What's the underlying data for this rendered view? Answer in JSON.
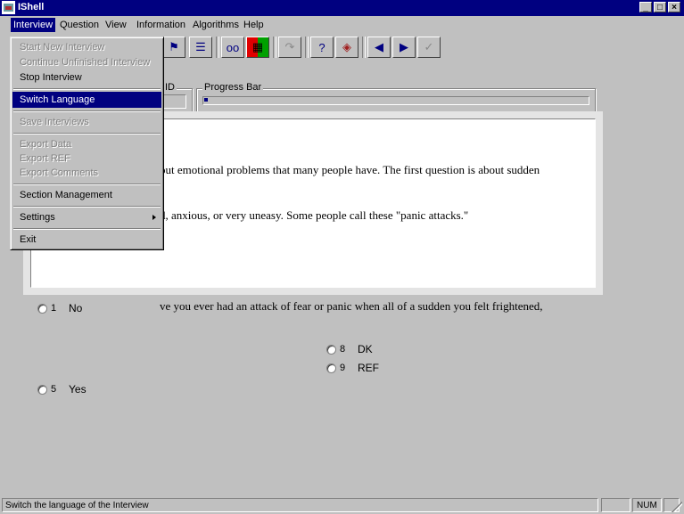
{
  "window": {
    "title": "IShell",
    "controls": [
      "minimize-icon",
      "maximize-icon",
      "close-icon"
    ]
  },
  "menubar": {
    "items": [
      "Interview",
      "Question",
      "View",
      "Information",
      "Algorithms",
      "Help"
    ]
  },
  "interview_menu": {
    "items": [
      {
        "label": "Start New Interview",
        "enabled": false
      },
      {
        "label": "Continue Unfinished Interview",
        "enabled": false
      },
      {
        "label": "Stop Interview",
        "enabled": true
      },
      {
        "label": "Switch Language",
        "enabled": true,
        "highlighted": true
      },
      {
        "label": "Save Interviews",
        "enabled": false
      },
      {
        "label": "Export Data",
        "enabled": false
      },
      {
        "label": "Export REF",
        "enabled": false
      },
      {
        "label": "Export Comments",
        "enabled": false
      },
      {
        "label": "Section Management",
        "enabled": true
      },
      {
        "label": "Settings",
        "enabled": true,
        "submenu": true
      },
      {
        "label": "Exit",
        "enabled": true
      }
    ]
  },
  "toolbar": {
    "icons": [
      "flag-icon",
      "checklist-icon",
      "glasses-icon",
      "color-grid-icon",
      "skip-icon",
      "help-icon",
      "book-icon",
      "previous-arrow-icon",
      "next-arrow-icon",
      "checkmark-icon"
    ]
  },
  "id_box": {
    "label": "ID",
    "value": ""
  },
  "progress": {
    "label": "Progress Bar",
    "fraction": 0.01
  },
  "question": {
    "line1": "out emotional problems that many people have. The first question is about sudden",
    "line2": "d, anxious, or very uneasy. Some people call these \"panic attacks.\"",
    "line3": "ve you ever had an attack of fear or panic when all of a sudden you felt frightened,"
  },
  "answers": [
    {
      "code": "1",
      "label": "No"
    },
    {
      "code": "8",
      "label": "DK"
    },
    {
      "code": "9",
      "label": "REF"
    },
    {
      "code": "5",
      "label": "Yes"
    }
  ],
  "statusbar": {
    "message": "Switch the language of the Interview",
    "pane1": "",
    "pane2": "NUM",
    "pane3": ""
  }
}
